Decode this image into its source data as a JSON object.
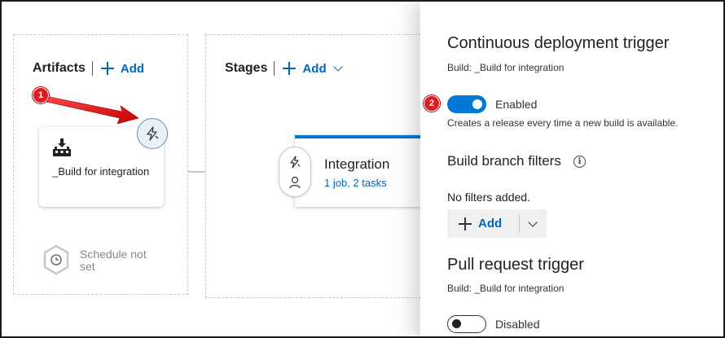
{
  "artifacts": {
    "title": "Artifacts",
    "add_label": "Add",
    "card": {
      "name": "_Build for integration"
    },
    "schedule_text": "Schedule not set"
  },
  "stages": {
    "title": "Stages",
    "add_label": "Add",
    "stage": {
      "name": "Integration",
      "detail": "1 job, 2 tasks"
    }
  },
  "annotations": {
    "badge_1": "1",
    "badge_2": "2",
    "arrow_color": "#e01b24"
  },
  "panel": {
    "cd_trigger": {
      "title": "Continuous deployment trigger",
      "build_label": "Build: _Build for integration",
      "toggle_state": "on",
      "toggle_label": "Enabled",
      "description": "Creates a release every time a new build is available."
    },
    "branch_filters": {
      "title": "Build branch filters",
      "info_glyph": "i",
      "empty_text": "No filters added.",
      "add_label": "Add"
    },
    "pr_trigger": {
      "title": "Pull request trigger",
      "build_label": "Build: _Build for integration",
      "toggle_state": "off",
      "toggle_label": "Disabled"
    }
  },
  "colors": {
    "accent": "#0078d4",
    "link": "#0067b8",
    "badge": "#e01b24"
  },
  "icons": {
    "build": "build-pipeline-icon",
    "trigger": "lightning-icon",
    "approver": "person-icon",
    "schedule": "clock-icon",
    "info": "info-icon",
    "add": "plus-icon",
    "dropdown": "chevron-down-icon"
  }
}
